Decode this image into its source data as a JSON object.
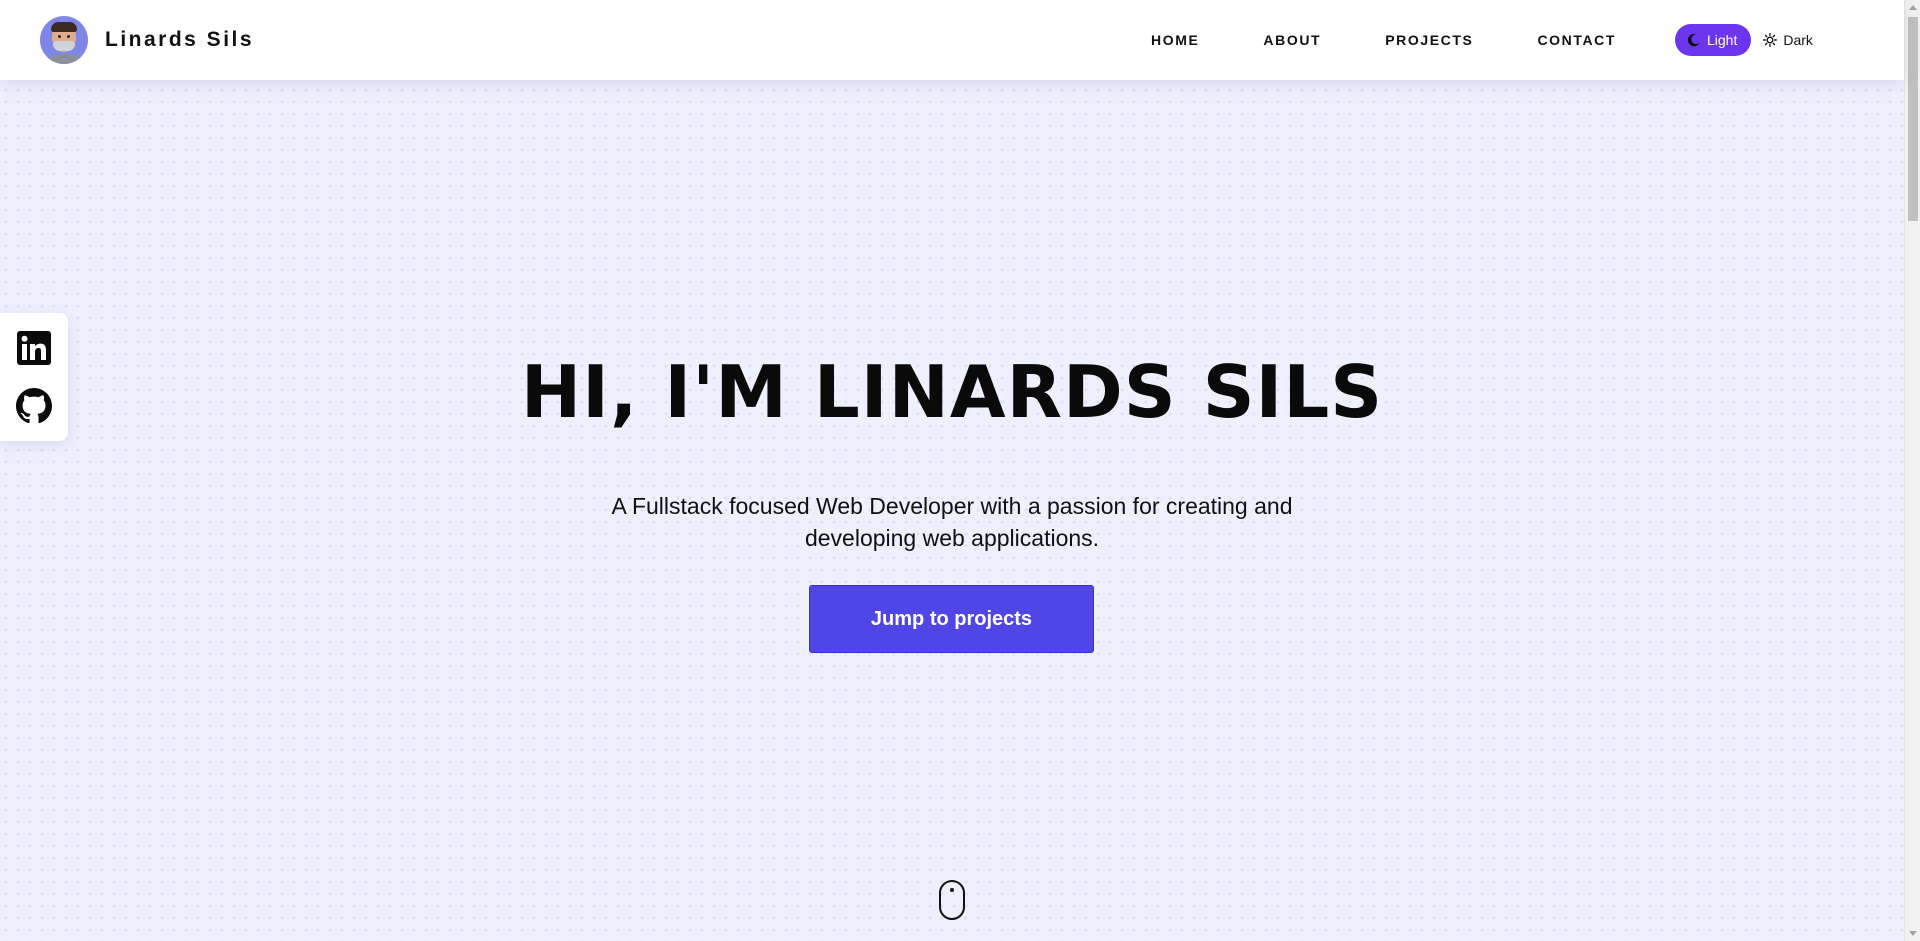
{
  "header": {
    "brand_name": "Linards Sils",
    "avatar_icon": "memoji-avatar-icon",
    "nav": [
      {
        "label": "HOME"
      },
      {
        "label": "ABOUT"
      },
      {
        "label": "PROJECTS"
      },
      {
        "label": "CONTACT"
      }
    ],
    "theme_toggle": {
      "light_label": "Light",
      "dark_label": "Dark",
      "active": "Light",
      "light_icon": "moon-icon",
      "dark_icon": "sun-icon",
      "active_color": "#6d35f0"
    }
  },
  "social": {
    "items": [
      {
        "icon": "linkedin-icon"
      },
      {
        "icon": "github-icon"
      }
    ]
  },
  "hero": {
    "title": "HI, I'M LINARDS SILS",
    "subtitle": "A Fullstack focused Web Developer with a passion for creating and developing web applications.",
    "cta_label": "Jump to projects",
    "cta_color": "#4f46e5",
    "scroll_icon": "mouse-scroll-icon"
  },
  "colors": {
    "background": "#eef0fd",
    "accent": "#4f46e5"
  }
}
